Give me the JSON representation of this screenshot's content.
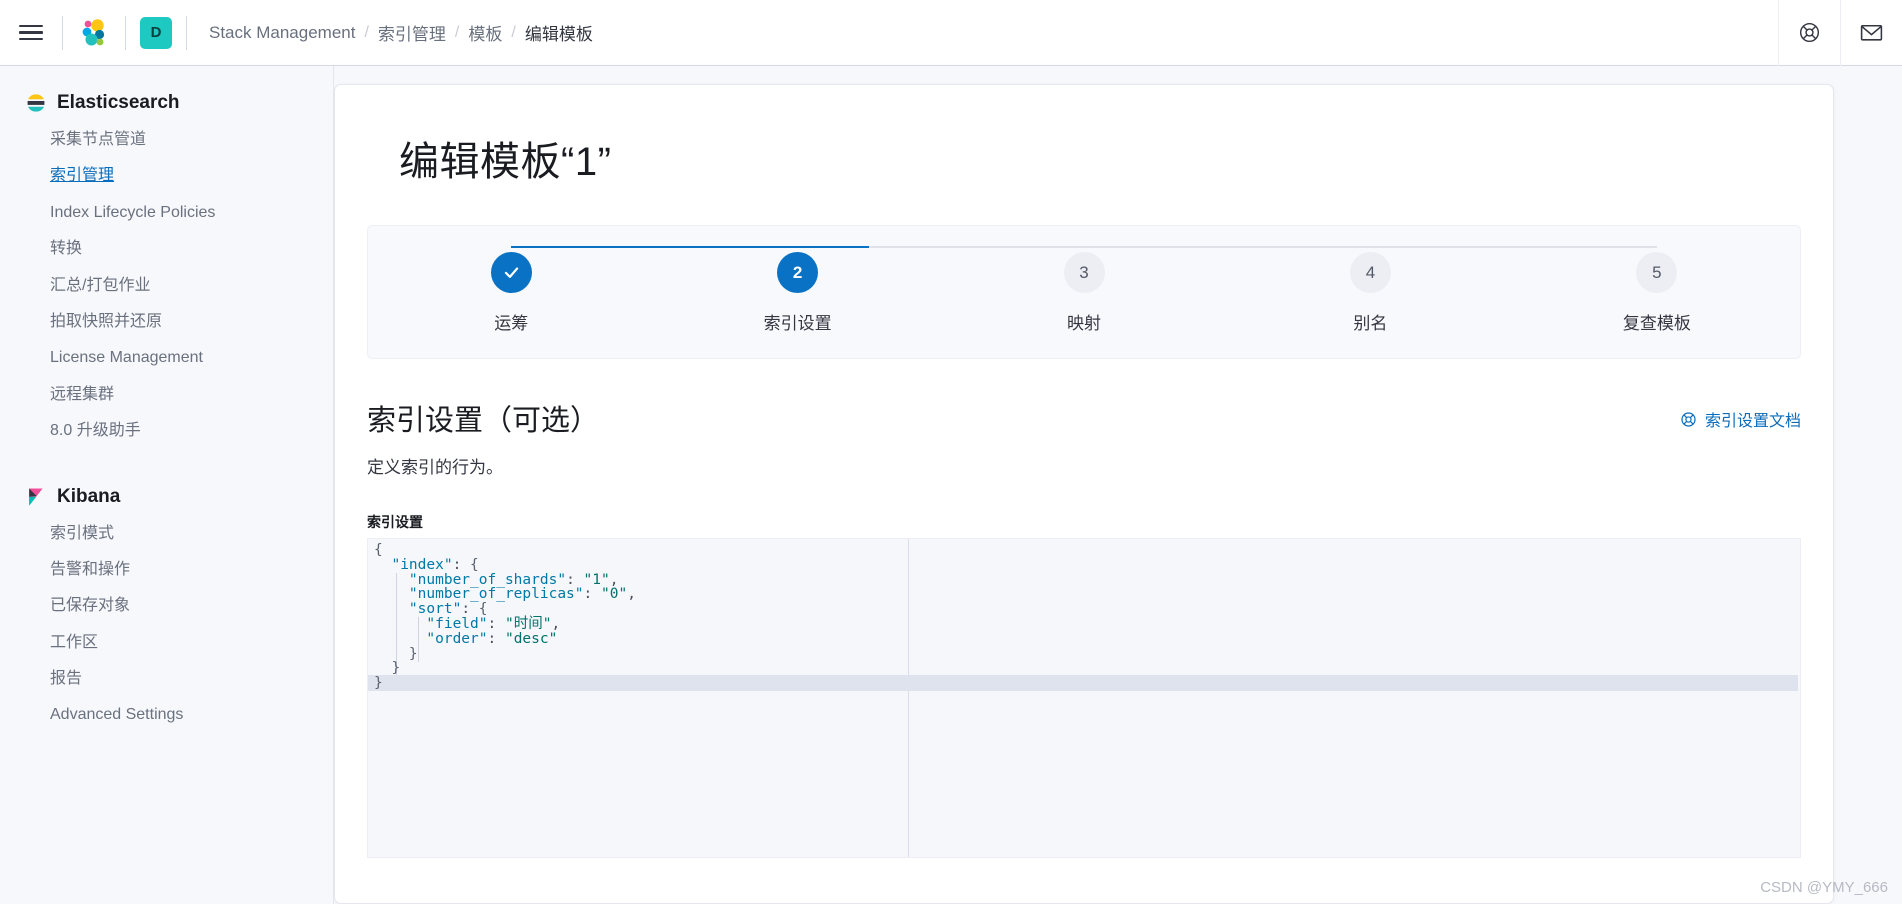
{
  "header": {
    "menu_icon": "hamburger-menu-icon",
    "logo_icon": "elastic-logo-icon",
    "avatar_label": "D",
    "breadcrumbs": [
      {
        "label": "Stack Management",
        "active": false
      },
      {
        "label": "索引管理",
        "active": false
      },
      {
        "label": "模板",
        "active": false
      },
      {
        "label": "编辑模板",
        "active": true
      }
    ],
    "separator": "/",
    "help_icon": "help-life-ring-icon",
    "mail_icon": "mail-envelope-icon"
  },
  "sidebar": {
    "groups": [
      {
        "title": "Elasticsearch",
        "icon": "elasticsearch-logo-icon",
        "items": [
          {
            "label": "采集节点管道",
            "selected": false
          },
          {
            "label": "索引管理",
            "selected": true
          },
          {
            "label": "Index Lifecycle Policies",
            "selected": false
          },
          {
            "label": "转换",
            "selected": false
          },
          {
            "label": "汇总/打包作业",
            "selected": false
          },
          {
            "label": "拍取快照并还原",
            "selected": false
          },
          {
            "label": "License Management",
            "selected": false
          },
          {
            "label": "远程集群",
            "selected": false
          },
          {
            "label": "8.0 升级助手",
            "selected": false
          }
        ]
      },
      {
        "title": "Kibana",
        "icon": "kibana-logo-icon",
        "items": [
          {
            "label": "索引模式",
            "selected": false
          },
          {
            "label": "告警和操作",
            "selected": false
          },
          {
            "label": "已保存对象",
            "selected": false
          },
          {
            "label": "工作区",
            "selected": false
          },
          {
            "label": "报告",
            "selected": false
          },
          {
            "label": "Advanced Settings",
            "selected": false
          }
        ]
      }
    ]
  },
  "page": {
    "title": "编辑模板“1”",
    "steps": [
      {
        "number": "1",
        "label": "运筹",
        "state": "done",
        "glyph": "✓"
      },
      {
        "number": "2",
        "label": "索引设置",
        "state": "active",
        "glyph": "2"
      },
      {
        "number": "3",
        "label": "映射",
        "state": "todo",
        "glyph": "3"
      },
      {
        "number": "4",
        "label": "别名",
        "state": "todo",
        "glyph": "4"
      },
      {
        "number": "5",
        "label": "复查模板",
        "state": "todo",
        "glyph": "5"
      }
    ],
    "section": {
      "title": "索引设置（可选）",
      "description": "定义索引的行为。",
      "doc_link_label": "索引设置文档",
      "doc_link_icon": "help-life-ring-icon"
    },
    "editor": {
      "label": "索引设置",
      "lines": [
        "{",
        "  \"index\": {",
        "    \"number_of_shards\": \"1\",",
        "    \"number_of_replicas\": \"0\",",
        "    \"sort\": {",
        "      \"field\": \"时间\",",
        "      \"order\": \"desc\"",
        "    }",
        "  }",
        "}"
      ],
      "highlighted_line_index": 9,
      "value": "{\n  \"index\": {\n    \"number_of_shards\": \"1\",\n    \"number_of_replicas\": \"0\",\n    \"sort\": {\n      \"field\": \"时间\",\n      \"order\": \"desc\"\n    }\n  }\n}"
    }
  },
  "colors": {
    "accent_blue": "#0a72c4",
    "link_blue": "#0b6cbb",
    "avatar_teal": "#1ec9c1",
    "editor_bg": "#f5f7fa"
  },
  "watermark": "CSDN @YMY_666"
}
